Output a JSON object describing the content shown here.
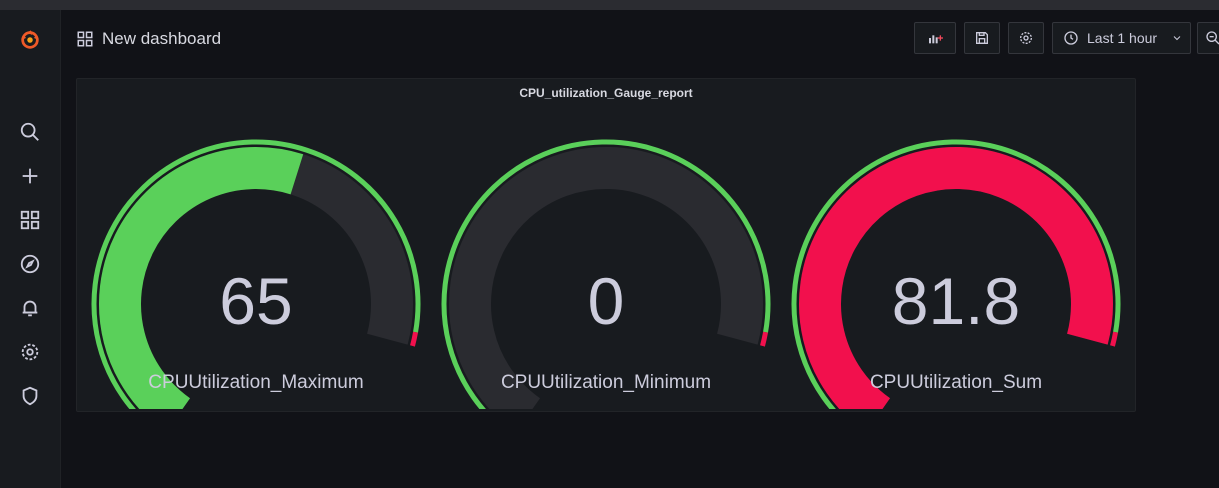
{
  "header": {
    "title": "New dashboard",
    "time_range": "Last 1 hour"
  },
  "sidebar": {
    "items": [
      {
        "icon": "search-icon"
      },
      {
        "icon": "plus-icon"
      },
      {
        "icon": "dashboards-icon"
      },
      {
        "icon": "explore-icon"
      },
      {
        "icon": "bell-icon"
      },
      {
        "icon": "gear-icon"
      },
      {
        "icon": "shield-icon"
      }
    ]
  },
  "panel": {
    "title": "CPU_utilization_Gauge_report",
    "gauges": [
      {
        "label": "CPUUtilization_Maximum",
        "value": "65",
        "fill_fraction": 0.65,
        "color": "#5ad05a"
      },
      {
        "label": "CPUUtilization_Minimum",
        "value": "0",
        "fill_fraction": 0.0,
        "color": "#5ad05a"
      },
      {
        "label": "CPUUtilization_Sum",
        "value": "81.8",
        "fill_fraction": 1.0,
        "color": "#f2104d"
      }
    ]
  },
  "colors": {
    "green": "#5ad05a",
    "red": "#f2104d",
    "track": "#2a2b30",
    "background": "#111217",
    "panel": "#181b1f"
  }
}
